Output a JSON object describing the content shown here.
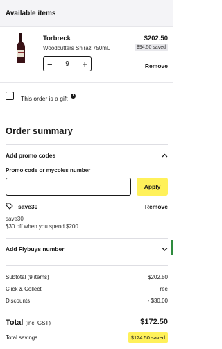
{
  "available_items": {
    "heading": "Available items",
    "item": {
      "title": "Torbreck",
      "subtitle": "Woodcutters Shiraz 750mL",
      "price": "$202.50",
      "saved": "$94.50 saved",
      "quantity": "9",
      "decrement_symbol": "−",
      "increment_symbol": "+",
      "remove_label": "Remove"
    }
  },
  "gift": {
    "label": "This order is a gift",
    "info_symbol": "i",
    "checked": false
  },
  "summary": {
    "title": "Order summary",
    "promo": {
      "section_label": "Add promo codes",
      "field_label": "Promo code or mycoles number",
      "input_value": "",
      "apply_label": "Apply",
      "applied_code": "save30",
      "applied_remove": "Remove",
      "desc_line1": "save30",
      "desc_line2": "$30 off when you spend $200"
    },
    "flybuys_label": "Add Flybuys number",
    "lines": [
      {
        "label": "Subtotal (9 items)",
        "value": "$202.50"
      },
      {
        "label": "Click & Collect",
        "value": "Free"
      },
      {
        "label": "Discounts",
        "value": "- $30.00"
      }
    ],
    "total_label": "Total",
    "total_note": "(inc. GST)",
    "total_value": "$172.50",
    "savings_label": "Total savings",
    "savings_value": "$124.50 saved"
  },
  "colors": {
    "accent_yellow": "#fff15a",
    "band_grey": "#f4f4f7",
    "text": "#1a1a1a",
    "edge_green": "#2e8b3e"
  },
  "icons": [
    "wine-bottle-icon",
    "minus-icon",
    "plus-icon",
    "checkbox-icon",
    "info-icon",
    "chevron-up-icon",
    "tag-icon",
    "chevron-down-icon"
  ]
}
